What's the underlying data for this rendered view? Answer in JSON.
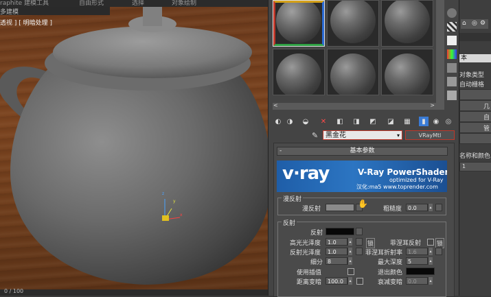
{
  "ribbon": {
    "items": [
      "raphite 建模工具",
      "自由形式",
      "选择",
      "对象绘制"
    ]
  },
  "viewport": {
    "tab_label": "多建模",
    "label": "透视 ] [ 明暗处理 ]",
    "status_text": "0 / 100"
  },
  "material_editor": {
    "name": "黑金花",
    "type": "VRayMtl",
    "rollout_title": "基本参数",
    "banner": {
      "logo": "v·ray",
      "title": "V-Ray PowerShader",
      "subtitle": "optimized for V-Ray",
      "credit": "汉化:ma5 www.toprender.com"
    },
    "diffuse": {
      "group": "漫反射",
      "label": "漫反射",
      "roughness_label": "粗糙度",
      "roughness_value": "0.0"
    },
    "reflect": {
      "group": "反射",
      "reflect_label": "反射",
      "hilight_label": "高光光泽度",
      "hilight_value": "1.0",
      "lock_label": "锁",
      "fresnel_label": "菲涅耳反射",
      "fresnel_lock_label": "锁",
      "refl_gloss_label": "反射光泽度",
      "refl_gloss_value": "1.0",
      "fresnel_ior_label": "菲涅耳折射率",
      "fresnel_ior_value": "1.6",
      "subdivs_label": "细分",
      "subdivs_value": "8",
      "max_depth_label": "最大深度",
      "max_depth_value": "5",
      "interp_label": "使用插值",
      "exit_color_label": "退出颜色",
      "dim_dist_label": "距离变暗",
      "dim_dist_value": "100.0",
      "dim_falloff_label": "衰减变暗",
      "dim_falloff_value": "0.0"
    }
  },
  "command_panel": {
    "category_label": "本",
    "object_type_label": "对象类型",
    "auto_grid_label": "自动栅格",
    "texts": [
      "几",
      "自",
      "管"
    ],
    "name_color_label": "名称和颜色",
    "field_value": "1"
  },
  "colors": {
    "viewport_wood": "#6b3a1c",
    "banner_blue": "#1f5ea8",
    "highlight_red": "#c0392b"
  }
}
